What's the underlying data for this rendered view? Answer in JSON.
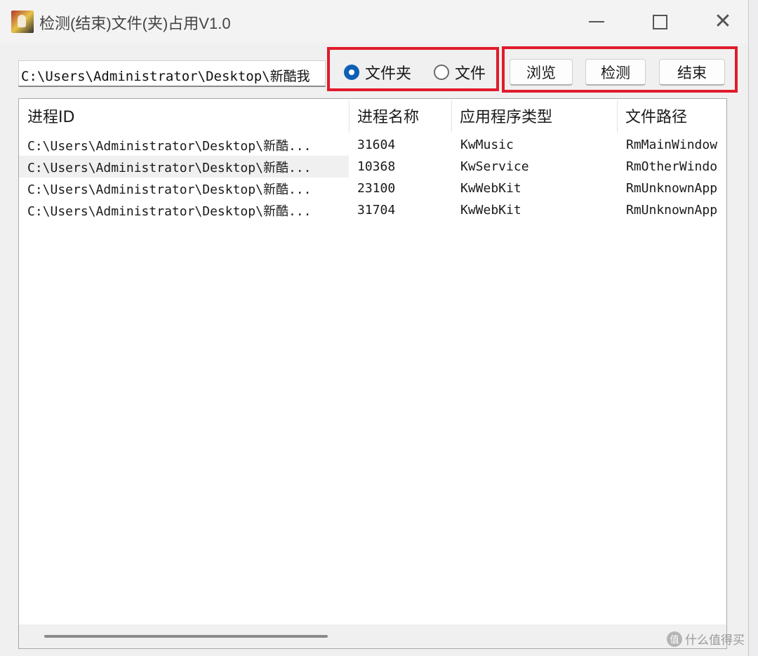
{
  "window": {
    "title": "检测(结束)文件(夹)占用V1.0",
    "controls": {
      "minimize": "—",
      "close": "✕"
    }
  },
  "toolbar": {
    "path_value": "C:\\Users\\Administrator\\Desktop\\新酷我",
    "radio_folder_label": "文件夹",
    "radio_file_label": "文件",
    "selected_radio": "folder",
    "browse_label": "浏览",
    "detect_label": "检测",
    "end_label": "结束"
  },
  "table": {
    "columns": [
      "进程ID",
      "进程名称",
      "应用程序类型",
      "文件路径"
    ],
    "rows": [
      {
        "path": "C:\\Users\\Administrator\\Desktop\\新酷...",
        "pid": "31604",
        "name": "KwMusic",
        "type": "RmMainWindow"
      },
      {
        "path": "C:\\Users\\Administrator\\Desktop\\新酷...",
        "pid": "10368",
        "name": "KwService",
        "type": "RmOtherWindo"
      },
      {
        "path": "C:\\Users\\Administrator\\Desktop\\新酷...",
        "pid": "23100",
        "name": "KwWebKit",
        "type": "RmUnknownApp"
      },
      {
        "path": "C:\\Users\\Administrator\\Desktop\\新酷...",
        "pid": "31704",
        "name": "KwWebKit",
        "type": "RmUnknownApp"
      }
    ],
    "selected_row": 1
  },
  "watermark": {
    "icon_text": "值",
    "text": "什么值得买"
  },
  "colors": {
    "highlight_box": "#e01b2b",
    "radio_selected": "#0f5fb5"
  }
}
